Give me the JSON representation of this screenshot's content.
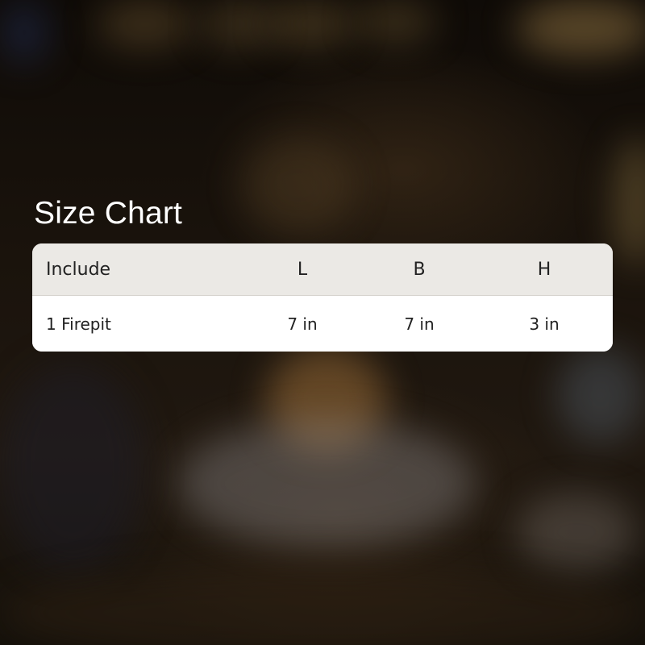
{
  "title": "Size Chart",
  "table": {
    "headers": [
      "Include",
      "L",
      "B",
      "H"
    ],
    "rows": [
      [
        "1 Firepit",
        "7 in",
        "7 in",
        "3 in"
      ]
    ]
  },
  "colors": {
    "header_background": "#ebe9e5",
    "row_background": "#ffffff",
    "title_text": "#ffffff",
    "cell_text": "#222222"
  }
}
